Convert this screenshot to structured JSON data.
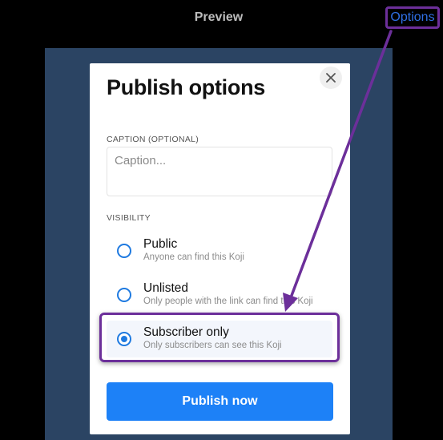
{
  "header": {
    "title": "Preview",
    "options_label": "Options"
  },
  "modal": {
    "title": "Publish options",
    "caption": {
      "label": "CAPTION (OPTIONAL)",
      "placeholder": "Caption...",
      "value": ""
    },
    "visibility": {
      "label": "VISIBILITY",
      "options": [
        {
          "title": "Public",
          "description": "Anyone can find this Koji",
          "selected": false
        },
        {
          "title": "Unlisted",
          "description": "Only people with the link can find this Koji",
          "selected": false
        },
        {
          "title": "Subscriber only",
          "description": "Only subscribers can see this Koji",
          "selected": true
        }
      ]
    },
    "publish_label": "Publish now"
  },
  "colors": {
    "annotation": "#6c2f9a",
    "accent": "#1d81f7",
    "stage_bg": "#2b4463"
  },
  "icons": {
    "close": "close-icon",
    "annotation_arrow": "arrow-icon"
  }
}
